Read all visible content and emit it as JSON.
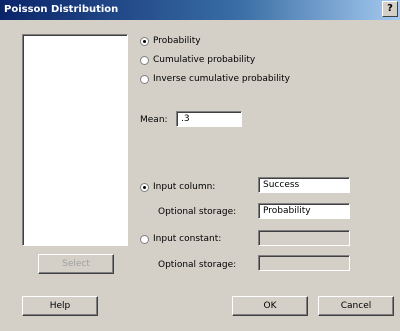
{
  "window": {
    "title": "Poisson Distribution",
    "help_glyph": "?"
  },
  "mode_options": [
    {
      "label": "Probability",
      "checked": true
    },
    {
      "label": "Cumulative probability",
      "checked": false
    },
    {
      "label": "Inverse cumulative probability",
      "checked": false
    }
  ],
  "mean": {
    "label": "Mean:",
    "value": ".3"
  },
  "input_column": {
    "label": "Input column:",
    "value": "Success",
    "checked": true
  },
  "optional_storage_1": {
    "label": "Optional storage:",
    "value": "Probability"
  },
  "input_constant": {
    "label": "Input constant:",
    "value": "",
    "checked": false
  },
  "optional_storage_2": {
    "label": "Optional storage:",
    "value": ""
  },
  "buttons": {
    "select": "Select",
    "help": "Help",
    "ok": "OK",
    "cancel": "Cancel"
  }
}
